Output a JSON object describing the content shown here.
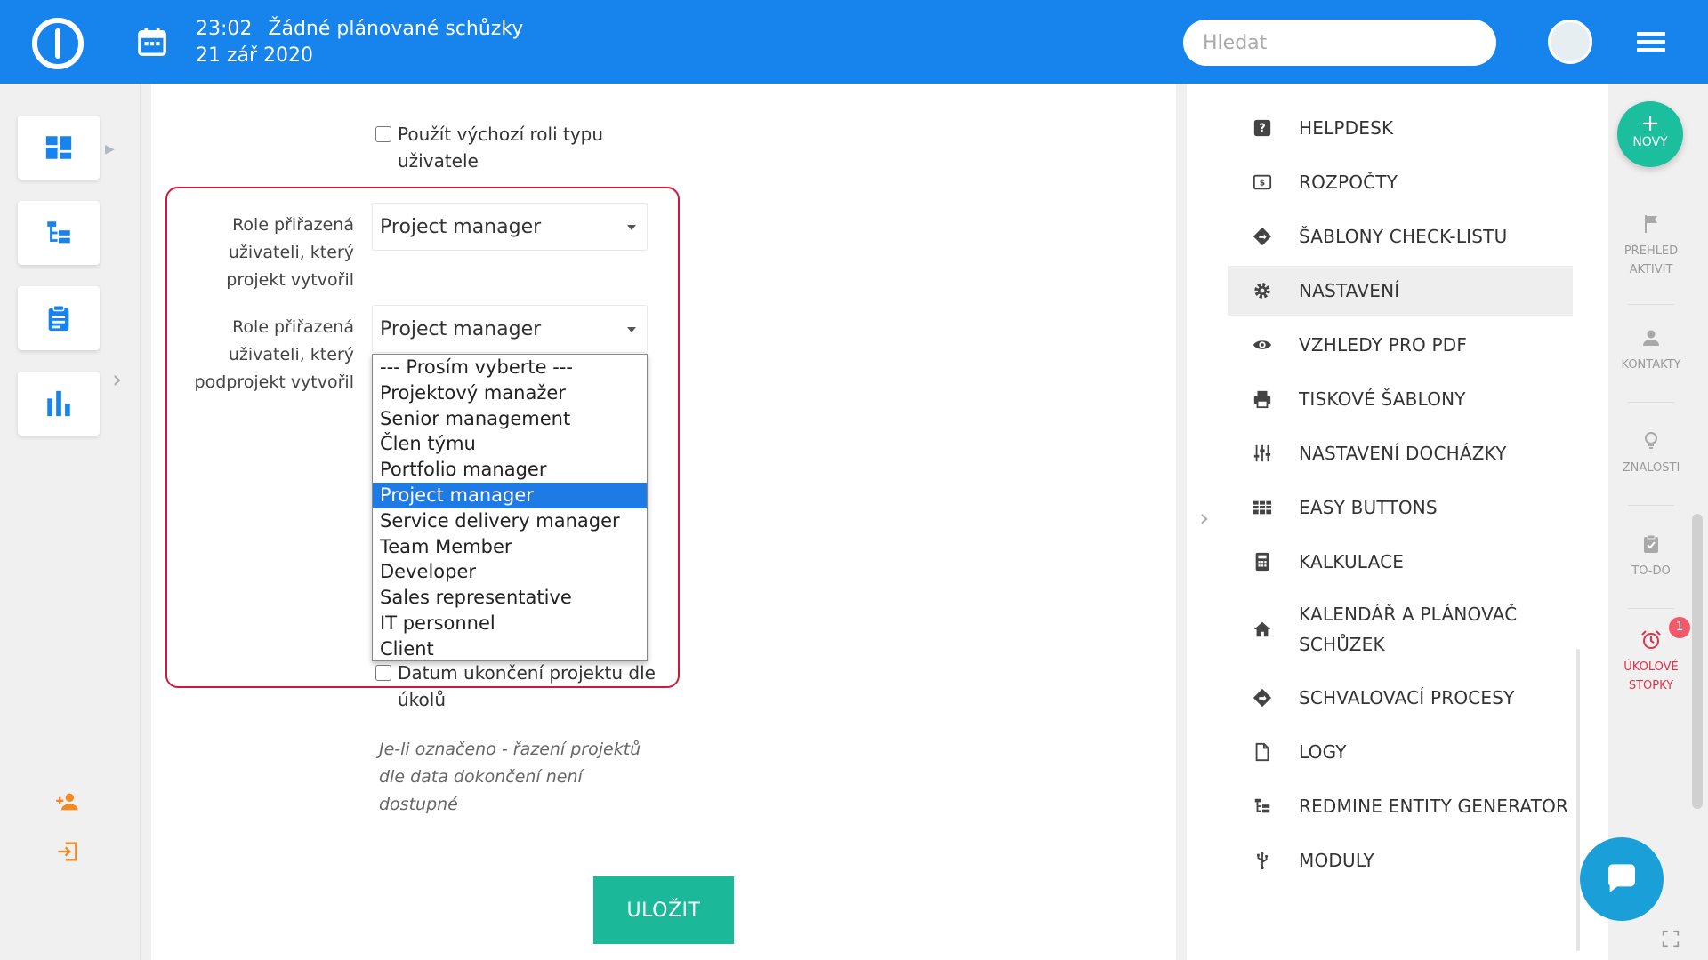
{
  "header": {
    "time": "23:02",
    "meeting_status": "Žádné plánované schůzky",
    "date": "21 zář 2020",
    "search_placeholder": "Hledat"
  },
  "form": {
    "checkbox_default_role": "Použít výchozí roli typu uživatele",
    "role_project_label": "Role přiřazená uživateli, který projekt vytvořil",
    "role_project_value": "Project manager",
    "role_subproject_label": "Role přiřazená uživateli, který podprojekt vytvořil",
    "role_subproject_value": "Project manager",
    "dropdown_options": [
      "--- Prosím vyberte ---",
      "Projektový manažer",
      "Senior management",
      "Člen týmu",
      "Portfolio manager",
      "Project manager",
      "Service delivery manager",
      "Team Member",
      "Developer",
      "Sales representative",
      "IT personnel",
      "Client"
    ],
    "dropdown_selected_index": 5,
    "checkbox_end_date": "Datum ukončení projektu dle úkolů",
    "end_date_note": "Je-li označeno - řazení projektů dle data dokončení není dostupné",
    "save_label": "ULOŽIT"
  },
  "menu": [
    {
      "label": "HELPDESK",
      "icon": "help-icon"
    },
    {
      "label": "ROZPOČTY",
      "icon": "budget-icon"
    },
    {
      "label": "ŠABLONY CHECK-LISTU",
      "icon": "diamond-arrow-icon"
    },
    {
      "label": "NASTAVENÍ",
      "icon": "gear-icon",
      "active": true
    },
    {
      "label": "VZHLEDY PRO PDF",
      "icon": "eye-icon"
    },
    {
      "label": "TISKOVÉ ŠABLONY",
      "icon": "printer-icon"
    },
    {
      "label": "NASTAVENÍ DOCHÁZKY",
      "icon": "sliders-icon"
    },
    {
      "label": "EASY BUTTONS",
      "icon": "grid-icon"
    },
    {
      "label": "KALKULACE",
      "icon": "calculator-icon"
    },
    {
      "label": "KALENDÁŘ A PLÁNOVAČ SCHŮZEK",
      "icon": "home-icon"
    },
    {
      "label": "SCHVALOVACÍ PROCESY",
      "icon": "diamond-arrow-icon"
    },
    {
      "label": "LOGY",
      "icon": "document-icon"
    },
    {
      "label": "REDMINE ENTITY GENERATOR",
      "icon": "tree-icon"
    },
    {
      "label": "MODULY",
      "icon": "usb-icon"
    }
  ],
  "far_rail": {
    "new_label": "NOVÝ",
    "activity_label": "PŘEHLED AKTIVIT",
    "contacts_label": "KONTAKTY",
    "knowledge_label": "ZNALOSTI",
    "todo_label": "TO-DO",
    "timers_label": "ÚKOLOVÉ STOPKY",
    "timers_badge": "1"
  },
  "colors": {
    "topbar": "#1684ec",
    "accent_green": "#1bb99a",
    "highlight_red": "#d0193a",
    "selected_option": "#1e7be6",
    "rail_icon_blue": "#1684ec",
    "alert_red": "#e0314b"
  }
}
